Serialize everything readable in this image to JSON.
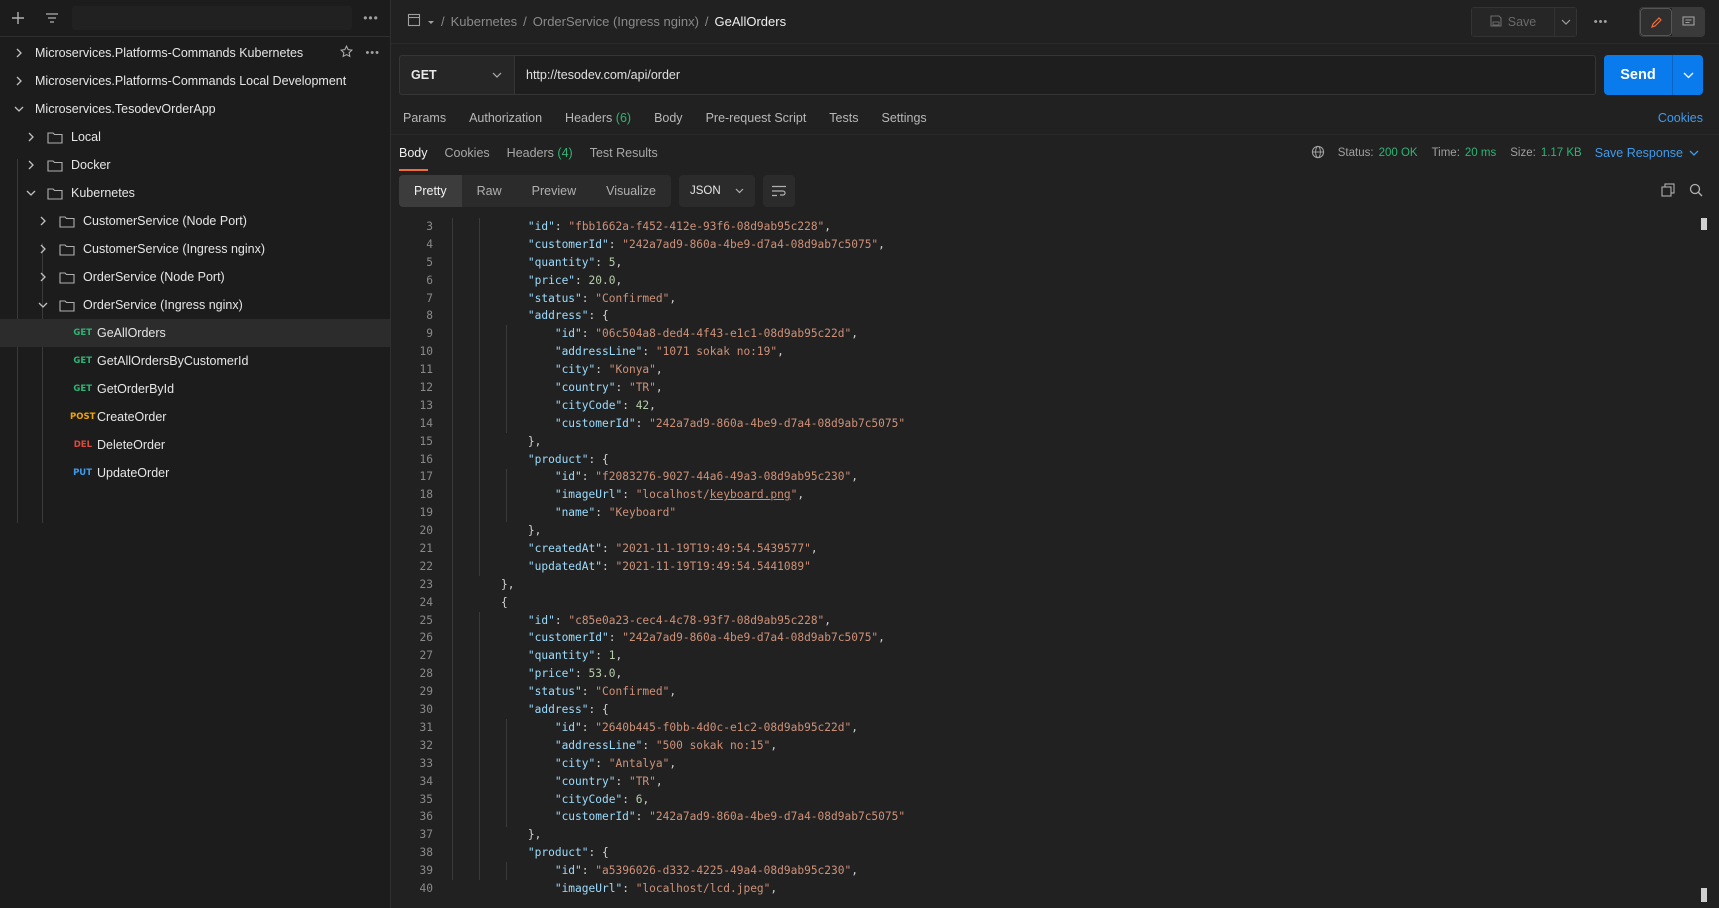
{
  "sidebar": {
    "collections": [
      {
        "label": "Microservices.Platforms-Commands Kubernetes"
      },
      {
        "label": "Microservices.Platforms-Commands Local Development"
      },
      {
        "label": "Microservices.TesodevOrderApp"
      }
    ],
    "folders": {
      "local": "Local",
      "docker": "Docker",
      "kubernetes": "Kubernetes",
      "customer_nodeport": "CustomerService (Node Port)",
      "customer_ingress": "CustomerService (Ingress nginx)",
      "order_nodeport": "OrderService (Node Port)",
      "order_ingress": "OrderService (Ingress nginx)"
    },
    "requests": [
      {
        "method": "GET",
        "name": "GeAllOrders"
      },
      {
        "method": "GET",
        "name": "GetAllOrdersByCustomerId"
      },
      {
        "method": "GET",
        "name": "GetOrderById"
      },
      {
        "method": "POST",
        "name": "CreateOrder"
      },
      {
        "method": "DEL",
        "name": "DeleteOrder"
      },
      {
        "method": "PUT",
        "name": "UpdateOrder"
      }
    ]
  },
  "breadcrumb": {
    "sep": "/",
    "parts": [
      "Kubernetes",
      "OrderService (Ingress nginx)"
    ],
    "current": "GeAllOrders"
  },
  "toolbar": {
    "save_label": "Save",
    "more": "•••"
  },
  "request": {
    "method": "GET",
    "url": "http://tesodev.com/api/order",
    "send_label": "Send"
  },
  "request_tabs": {
    "params": "Params",
    "authorization": "Authorization",
    "headers": "Headers",
    "headers_count": "(6)",
    "body": "Body",
    "prerequest": "Pre-request Script",
    "tests": "Tests",
    "settings": "Settings",
    "cookies": "Cookies"
  },
  "response_tabs": {
    "body": "Body",
    "cookies": "Cookies",
    "headers": "Headers",
    "headers_count": "(4)",
    "test_results": "Test Results"
  },
  "response_meta": {
    "status_label": "Status:",
    "status_value": "200 OK",
    "time_label": "Time:",
    "time_value": "20 ms",
    "size_label": "Size:",
    "size_value": "1.17 KB",
    "save_response": "Save Response"
  },
  "view": {
    "modes": [
      "Pretty",
      "Raw",
      "Preview",
      "Visualize"
    ],
    "format": "JSON"
  },
  "code_lines": [
    {
      "n": "3",
      "t": "        \"id\": \"fbb1662a-f452-412e-93f6-08d9ab95c228\","
    },
    {
      "n": "4",
      "t": "        \"customerId\": \"242a7ad9-860a-4be9-d7a4-08d9ab7c5075\","
    },
    {
      "n": "5",
      "t": "        \"quantity\": 5,"
    },
    {
      "n": "6",
      "t": "        \"price\": 20.0,"
    },
    {
      "n": "7",
      "t": "        \"status\": \"Confirmed\","
    },
    {
      "n": "8",
      "t": "        \"address\": {"
    },
    {
      "n": "9",
      "t": "            \"id\": \"06c504a8-ded4-4f43-e1c1-08d9ab95c22d\","
    },
    {
      "n": "10",
      "t": "            \"addressLine\": \"1071 sokak no:19\","
    },
    {
      "n": "11",
      "t": "            \"city\": \"Konya\","
    },
    {
      "n": "12",
      "t": "            \"country\": \"TR\","
    },
    {
      "n": "13",
      "t": "            \"cityCode\": 42,"
    },
    {
      "n": "14",
      "t": "            \"customerId\": \"242a7ad9-860a-4be9-d7a4-08d9ab7c5075\""
    },
    {
      "n": "15",
      "t": "        },"
    },
    {
      "n": "16",
      "t": "        \"product\": {"
    },
    {
      "n": "17",
      "t": "            \"id\": \"f2083276-9027-44a6-49a3-08d9ab95c230\","
    },
    {
      "n": "18",
      "t": "            \"imageUrl\": \"localhost/keyboard.png\","
    },
    {
      "n": "19",
      "t": "            \"name\": \"Keyboard\""
    },
    {
      "n": "20",
      "t": "        },"
    },
    {
      "n": "21",
      "t": "        \"createdAt\": \"2021-11-19T19:49:54.5439577\","
    },
    {
      "n": "22",
      "t": "        \"updatedAt\": \"2021-11-19T19:49:54.5441089\""
    },
    {
      "n": "23",
      "t": "    },"
    },
    {
      "n": "24",
      "t": "    {"
    },
    {
      "n": "25",
      "t": "        \"id\": \"c85e0a23-cec4-4c78-93f7-08d9ab95c228\","
    },
    {
      "n": "26",
      "t": "        \"customerId\": \"242a7ad9-860a-4be9-d7a4-08d9ab7c5075\","
    },
    {
      "n": "27",
      "t": "        \"quantity\": 1,"
    },
    {
      "n": "28",
      "t": "        \"price\": 53.0,"
    },
    {
      "n": "29",
      "t": "        \"status\": \"Confirmed\","
    },
    {
      "n": "30",
      "t": "        \"address\": {"
    },
    {
      "n": "31",
      "t": "            \"id\": \"2640b445-f0bb-4d0c-e1c2-08d9ab95c22d\","
    },
    {
      "n": "32",
      "t": "            \"addressLine\": \"500 sokak no:15\","
    },
    {
      "n": "33",
      "t": "            \"city\": \"Antalya\","
    },
    {
      "n": "34",
      "t": "            \"country\": \"TR\","
    },
    {
      "n": "35",
      "t": "            \"cityCode\": 6,"
    },
    {
      "n": "36",
      "t": "            \"customerId\": \"242a7ad9-860a-4be9-d7a4-08d9ab7c5075\""
    },
    {
      "n": "37",
      "t": "        },"
    },
    {
      "n": "38",
      "t": "        \"product\": {"
    },
    {
      "n": "39",
      "t": "            \"id\": \"a5396026-d332-4225-49a4-08d9ab95c230\","
    },
    {
      "n": "40",
      "t": "            \"imageUrl\": \"localhost/lcd.jpeg\","
    }
  ],
  "colors": {
    "accent": "#097bed",
    "active_tab": "#f26b3a",
    "status_ok": "#2bb673",
    "link": "#3e9bec"
  },
  "icons": [
    "plus-icon",
    "filter-icon",
    "more-icon",
    "chevron-right-icon",
    "chevron-down-icon",
    "folder-icon",
    "star-icon",
    "collection-icon",
    "save-icon",
    "edit-icon",
    "comment-icon",
    "globe-icon",
    "copy-icon",
    "search-icon",
    "wrap-icon"
  ]
}
